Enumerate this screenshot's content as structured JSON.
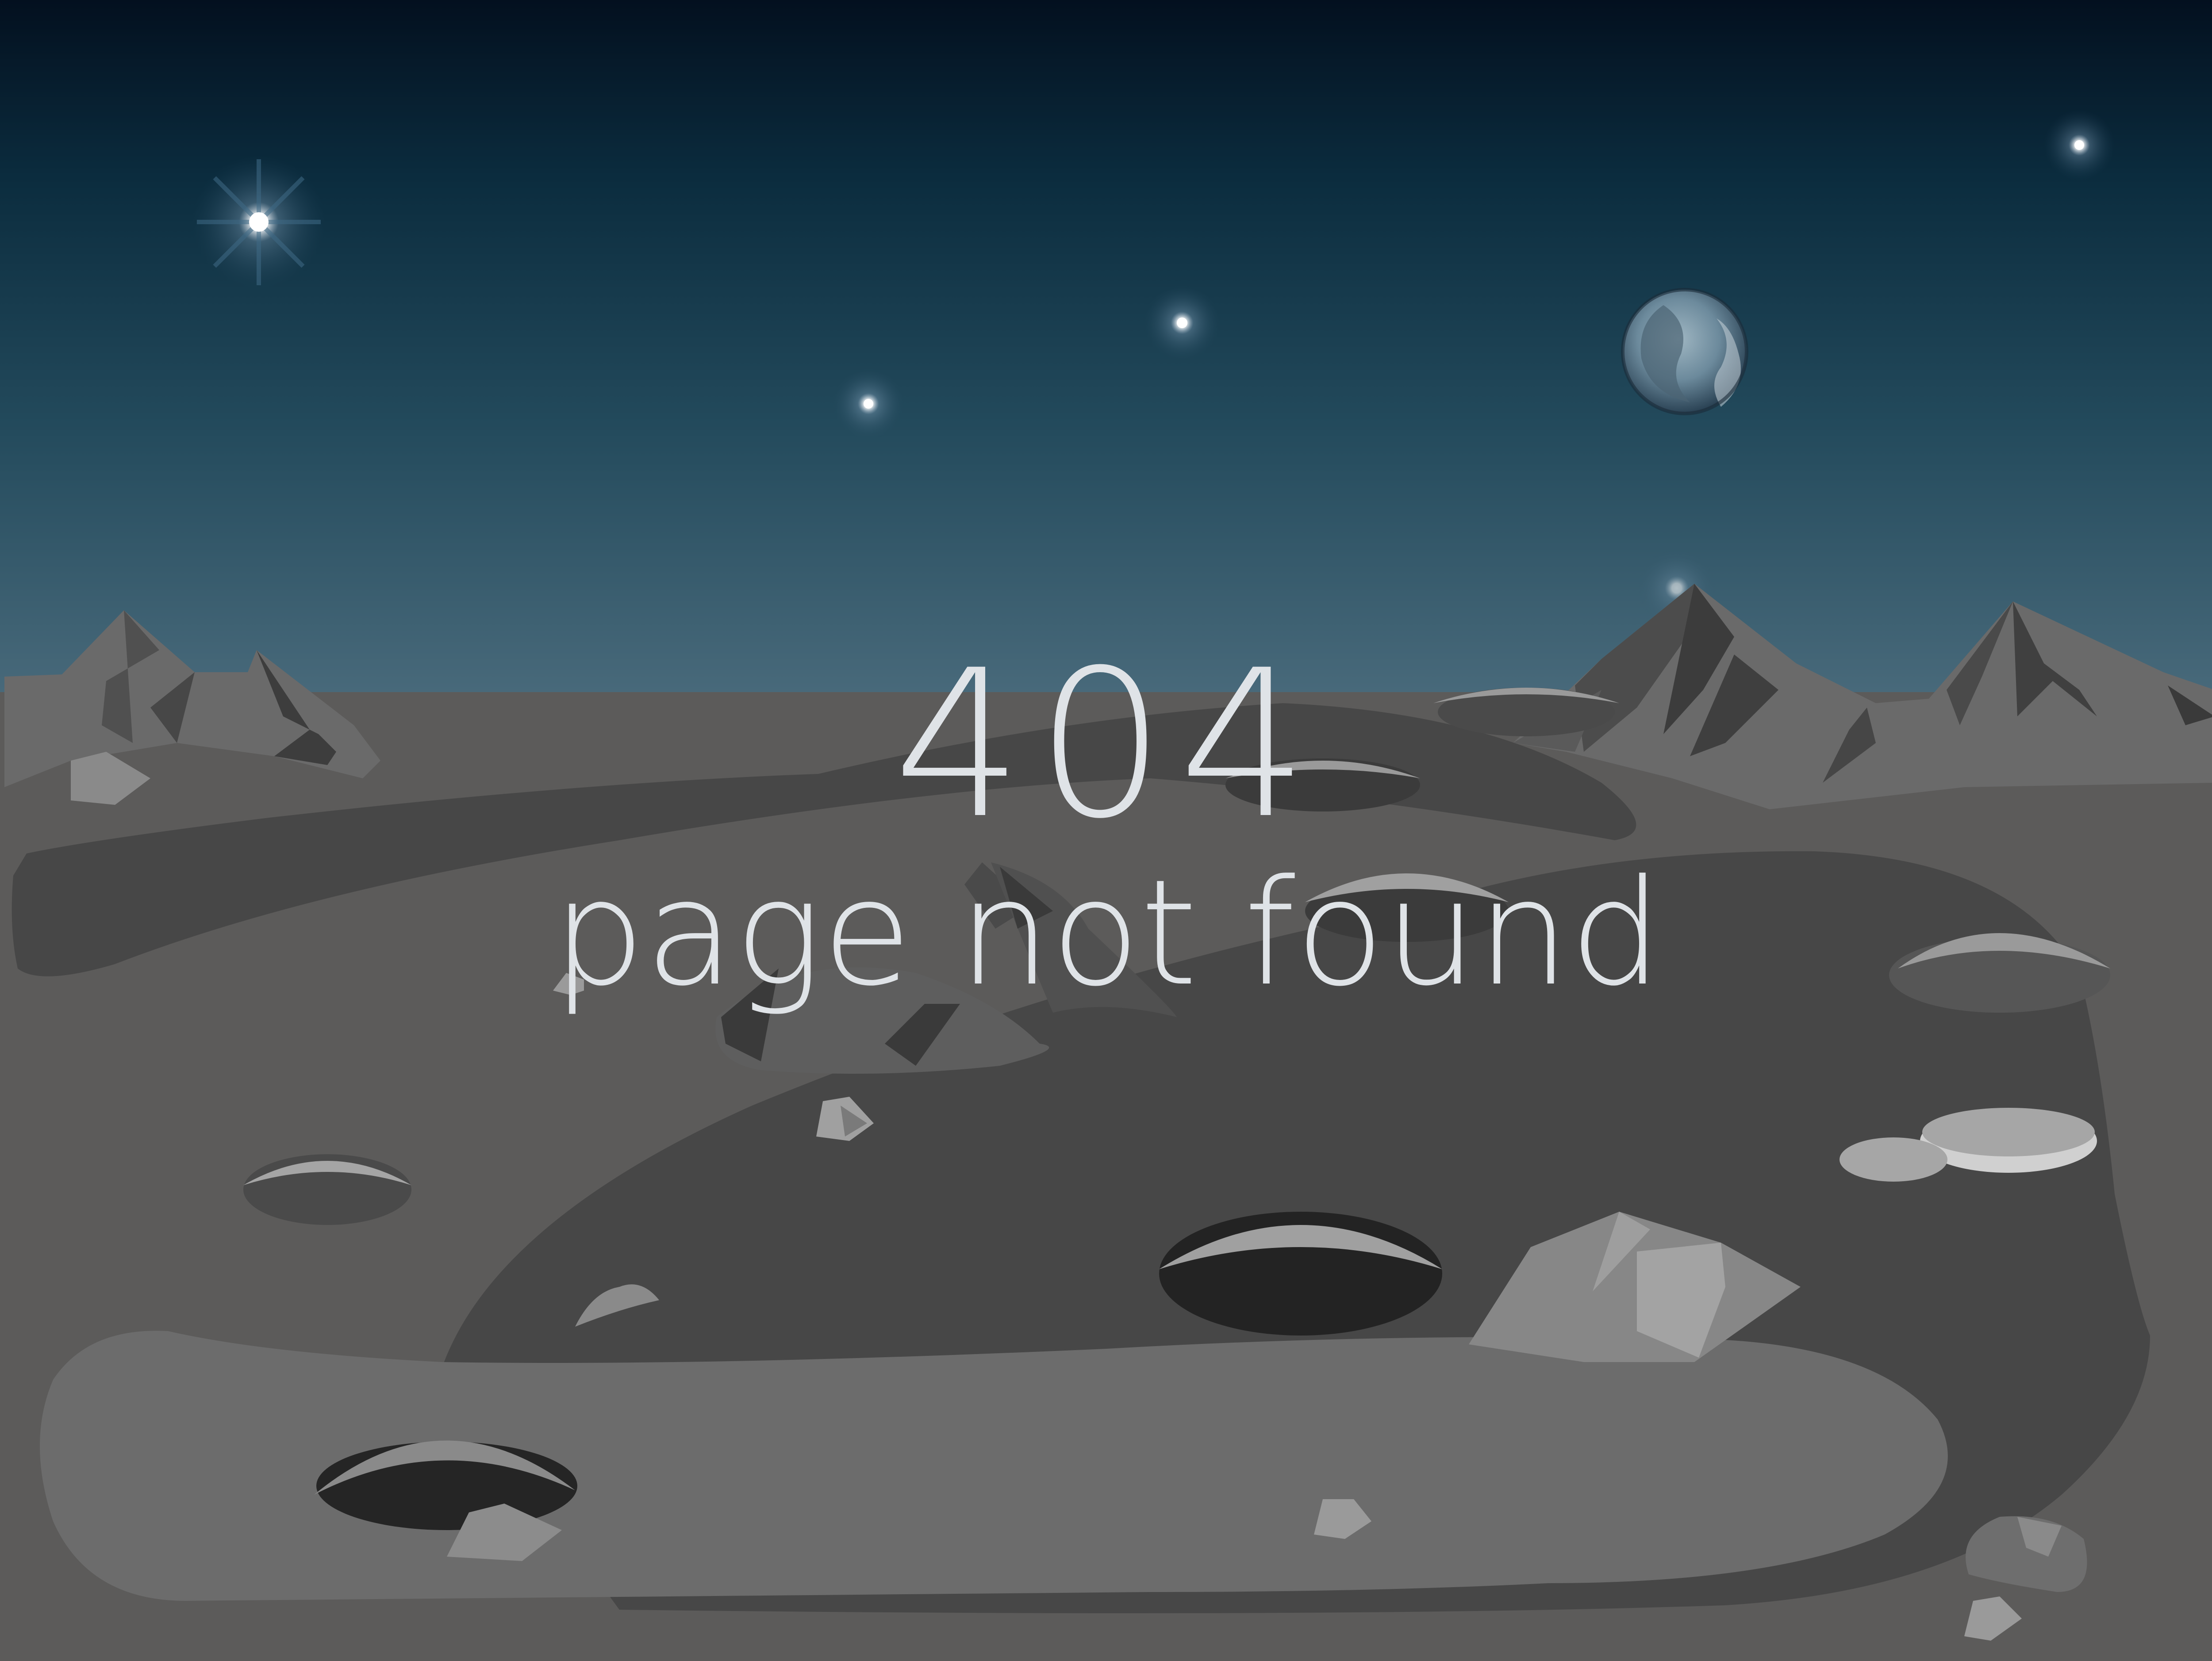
{
  "error": {
    "code": "404",
    "message": "page not found"
  },
  "colors": {
    "sky_top": "#03101f",
    "sky_bottom": "#4a6b7c",
    "ground": "#5c5b5a",
    "ground_dark": "#474747",
    "ground_light": "#6c6c6c",
    "mountain": "#6a6a6a",
    "text": "#dfe3e7"
  },
  "icons": {
    "planet": "earth-planet-icon",
    "stars": "star-icon",
    "mountains": "mountain-icon",
    "craters": "crater-icon",
    "rocks": "rock-icon"
  }
}
